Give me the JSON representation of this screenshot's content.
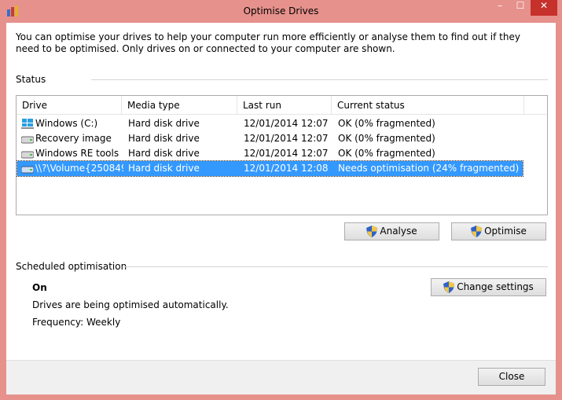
{
  "window": {
    "title": "Optimise Drives",
    "accent": "#e6918c",
    "close_glyph": "✕",
    "min_glyph": "–",
    "max_glyph": "☐"
  },
  "intro": "You can optimise your drives to help your computer run more efficiently or analyse them to find out if they need to be optimised. Only drives on or connected to your computer are shown.",
  "status": {
    "label": "Status",
    "columns": [
      "Drive",
      "Media type",
      "Last run",
      "Current status"
    ],
    "rows": [
      {
        "drive": "Windows (C:)",
        "media": "Hard disk drive",
        "last_run": "12/01/2014 12:07",
        "status": "OK (0% fragmented)",
        "icon": "windows-drive-icon"
      },
      {
        "drive": "Recovery image",
        "media": "Hard disk drive",
        "last_run": "12/01/2014 12:07",
        "status": "OK (0% fragmented)",
        "icon": "hard-drive-icon"
      },
      {
        "drive": "Windows RE tools",
        "media": "Hard disk drive",
        "last_run": "12/01/2014 12:07",
        "status": "OK (0% fragmented)",
        "icon": "hard-drive-icon"
      },
      {
        "drive": "\\\\?\\Volume{250849...",
        "media": "Hard disk drive",
        "last_run": "12/01/2014 12:08",
        "status": "Needs optimisation (24% fragmented)",
        "icon": "hard-drive-icon",
        "selected": true
      }
    ],
    "analyse_label": "Analyse",
    "optimise_label": "Optimise"
  },
  "scheduled": {
    "label": "Scheduled optimisation",
    "state": "On",
    "description": "Drives are being optimised automatically.",
    "frequency": "Frequency: Weekly",
    "change_label": "Change settings"
  },
  "close_label": "Close",
  "selection_color": "#3399ff"
}
